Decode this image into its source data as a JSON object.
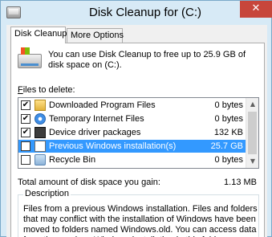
{
  "window": {
    "title": "Disk Cleanup for  (C:)",
    "close_glyph": "✕"
  },
  "tabs": [
    {
      "label": "Disk Cleanup",
      "active": true
    },
    {
      "label": "More Options",
      "active": false
    }
  ],
  "intro_text": "You can use Disk Cleanup to free up to 25.9 GB of disk space on  (C:).",
  "files_label_accel": "F",
  "files_label_rest": "iles to delete:",
  "file_list": [
    {
      "label": "Downloaded Program Files",
      "size": "0 bytes",
      "checked": true,
      "icon": "folder-icon",
      "selected": false
    },
    {
      "label": "Temporary Internet Files",
      "size": "0 bytes",
      "checked": true,
      "icon": "internet-explorer-icon",
      "selected": false
    },
    {
      "label": "Device driver packages",
      "size": "132 KB",
      "checked": true,
      "icon": "driver-icon",
      "selected": false
    },
    {
      "label": "Previous Windows installation(s)",
      "size": "25.7 GB",
      "checked": false,
      "icon": "document-icon",
      "selected": true
    },
    {
      "label": "Recycle Bin",
      "size": "0 bytes",
      "checked": false,
      "icon": "recycle-bin-icon",
      "selected": false
    }
  ],
  "check_glyph": "✔",
  "scroll": {
    "up": "▲",
    "down": "▼"
  },
  "total": {
    "label": "Total amount of disk space you gain:",
    "value": "1.13 MB"
  },
  "description": {
    "title": "Description",
    "text": "Files from a previous Windows installation.  Files and folders that may conflict with the installation of Windows have been moved to folders named Windows.old.  You can access data from the previous Windows installation in this folder."
  },
  "colors": {
    "selection": "#3399ff",
    "title_bar": "#d7eaf6",
    "close_button": "#c7463b"
  }
}
